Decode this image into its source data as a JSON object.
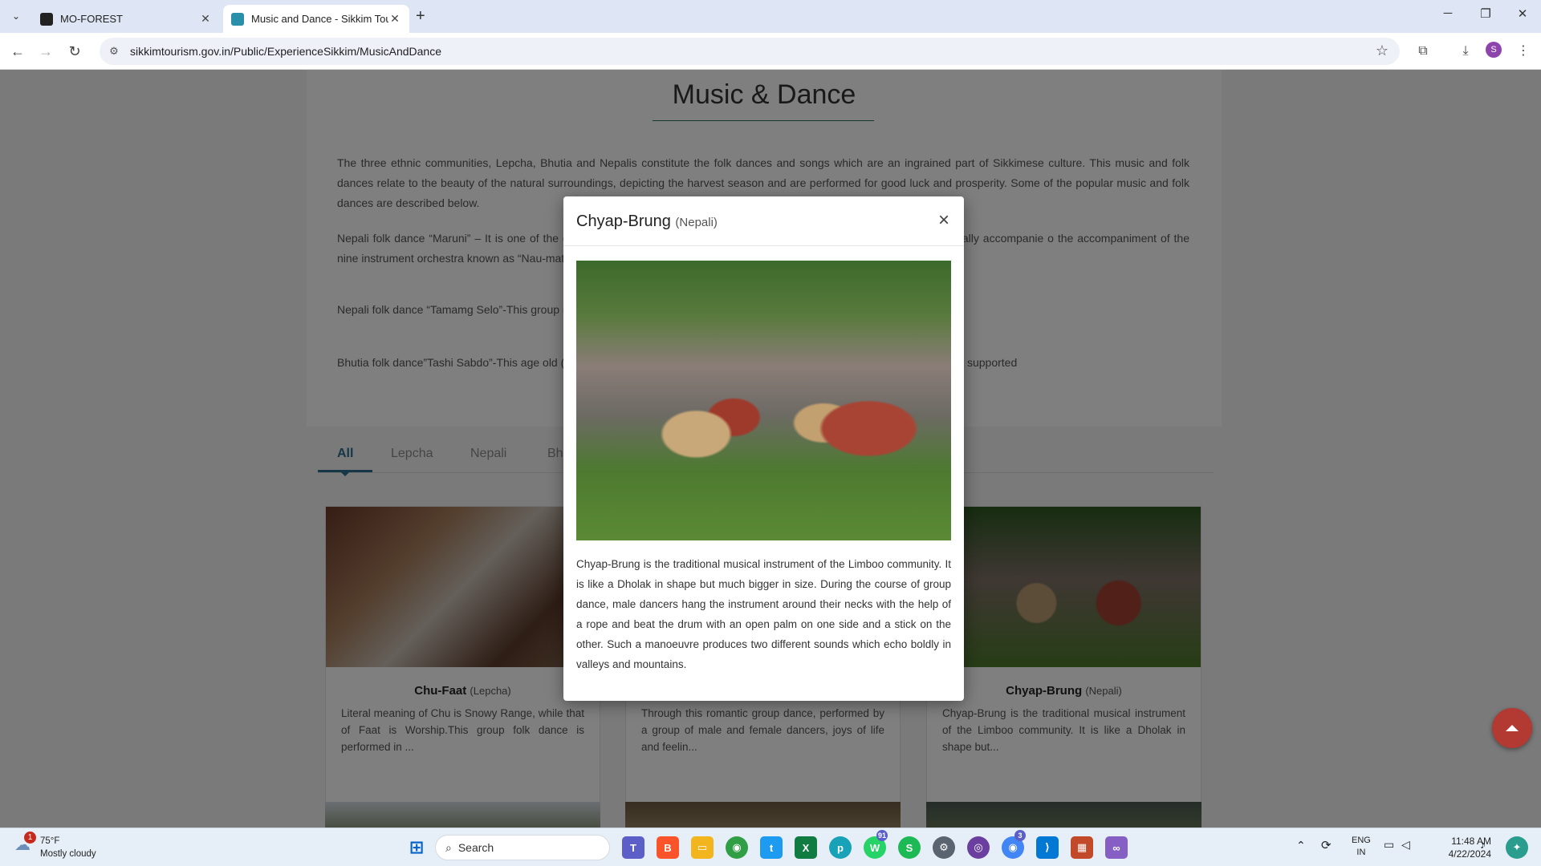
{
  "browser": {
    "tabs": [
      {
        "title": "MO-FOREST",
        "close": "✕"
      },
      {
        "title": "Music and Dance - Sikkim Tour",
        "close": "✕"
      }
    ],
    "new_tab": "+",
    "url": "sikkimtourism.gov.in/Public/ExperienceSikkim/MusicAndDance",
    "profile_initial": "S",
    "window_controls": {
      "minimize": "─",
      "restore": "❐",
      "close": "✕"
    }
  },
  "page": {
    "title": "Music & Dance",
    "paragraphs": [
      "The three ethnic communities, Lepcha, Bhutia and Nepalis constitute the folk dances and songs which are an ingrained part of Sikkimese culture. This music and folk dances relate to the beauty of the natural surroundings, depicting the harvest season and are performed for good luck and prosperity. Some of the popular music and folk dances are described below.",
      "Nepali folk dance “Maruni” – It is one of the o                                                                                                                                                  d by three male dancers and the three female dancers. The dancers are usually accompanie                                                                                                                                                 o the accompaniment of the nine instrument orchestra known as “Nau-mati Baja”.",
      "Nepali folk dance “Tamamg Selo”-This group                                                                                                                                                  nu”, a musical instrument and hence are also called “Dhamphu ” dance.",
      "Bhutia folk dance”Tashi Sabdo”-This age old                                                                                                                                                  (Scarfs) 0n auspicious occasion. The dancers dance to the melodious tunes dully supported"
    ],
    "filter_tabs": [
      "All",
      "Lepcha",
      "Nepali",
      "Bhu"
    ],
    "cards": [
      {
        "name": "Chu-Faat",
        "community": "(Lepcha)",
        "desc": "Literal meaning of Chu is Snowy Range, while that of Faat is Worship.This group folk dance is performed in ..."
      },
      {
        "name": "",
        "community": "",
        "desc": "Through this romantic group dance, performed by a group of male and female dancers, joys of life and feelin..."
      },
      {
        "name": "Chyap-Brung",
        "community": "(Nepali)",
        "desc": "Chyap-Brung is the traditional musical instrument of the Limboo community. It is like a Dholak in shape but..."
      }
    ]
  },
  "modal": {
    "title": "Chyap-Brung",
    "subtitle": "(Nepali)",
    "close": "×",
    "description": "Chyap-Brung is the traditional musical instrument of the Limboo community. It is like a Dholak in shape but much bigger in size. During the course of group dance, male dancers hang the instrument around their necks with the help of a rope and beat the drum with an open palm on one side and a stick on the other. Such a manoeuvre produces two different sounds which echo boldly in valleys and mountains."
  },
  "taskbar": {
    "weather_temp": "75°F",
    "weather_desc": "Mostly cloudy",
    "weather_badge": "1",
    "search": "Search",
    "whatsapp_badge": "91",
    "chrome_badge": "3",
    "lang_1": "ENG",
    "lang_2": "IN",
    "time": "11:48 AM",
    "date": "4/22/2024"
  },
  "colors": {
    "accent": "#2b6e8e",
    "scroll_button": "#b23a32",
    "taskbar": "#e6eef7"
  }
}
